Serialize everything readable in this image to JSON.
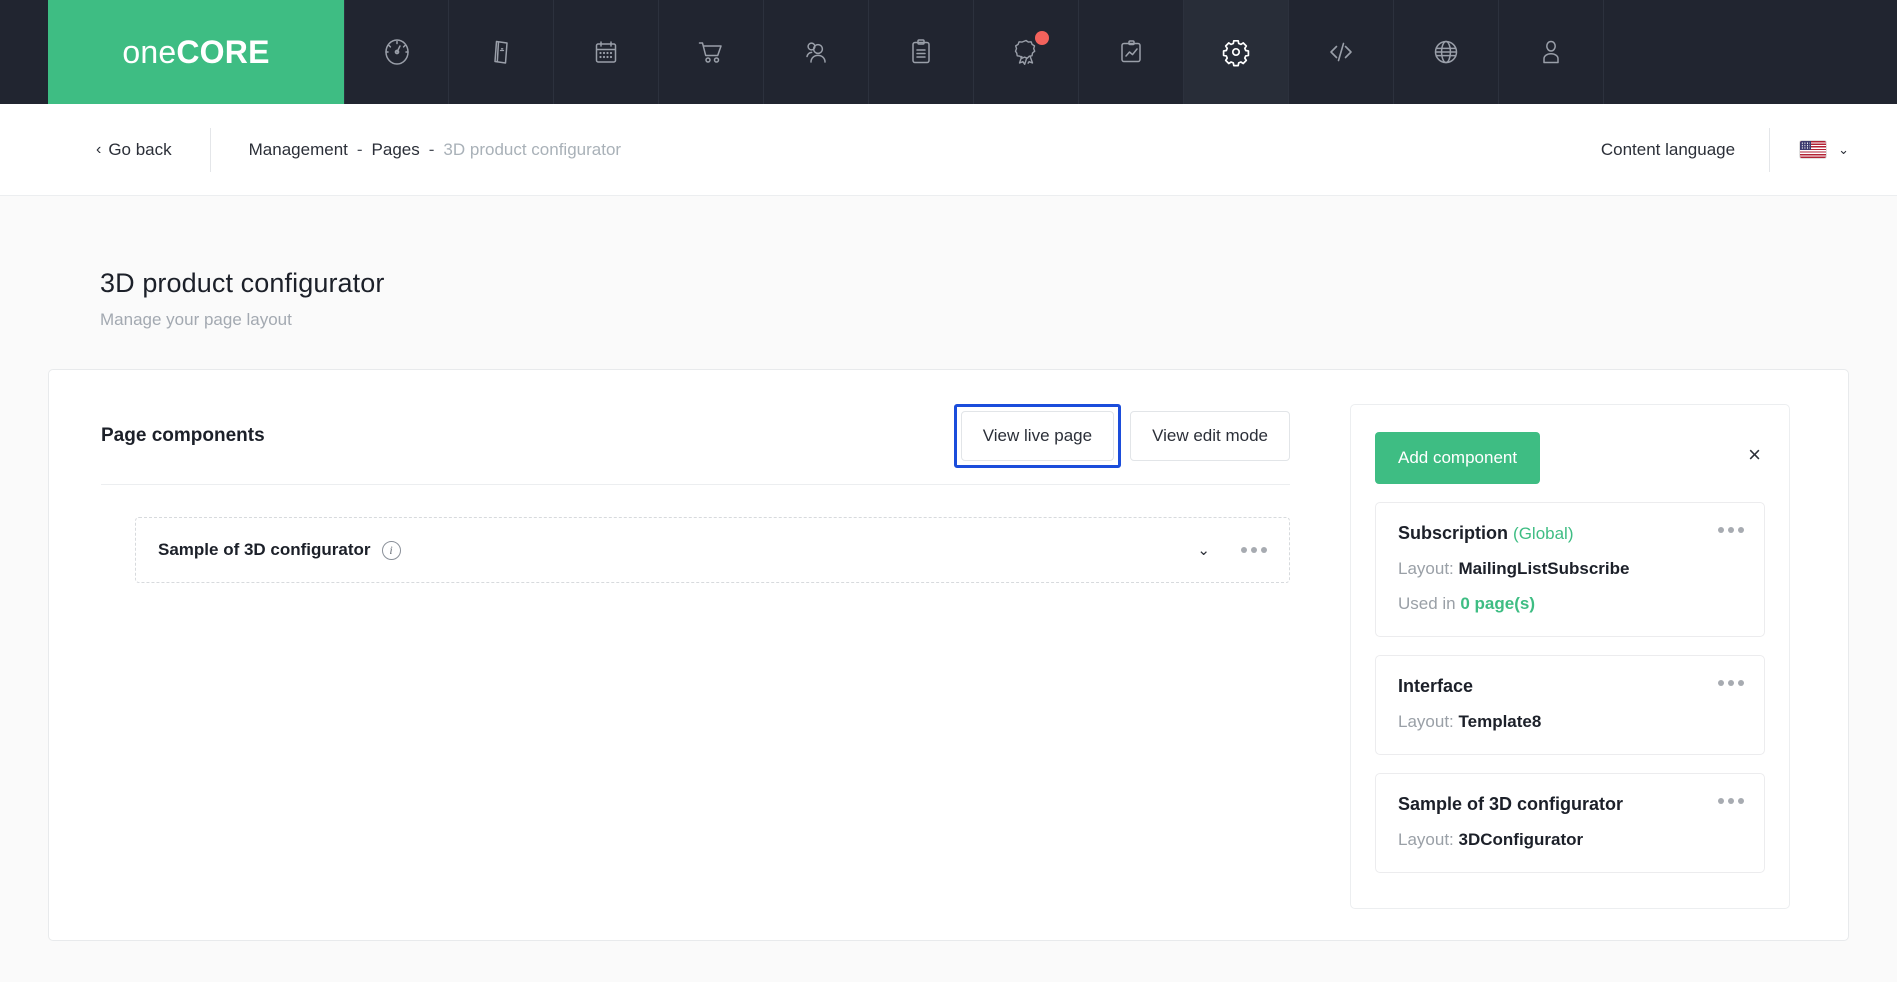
{
  "brand": {
    "logo_light": "one",
    "logo_bold": "CORE"
  },
  "topnav": {
    "items": [
      {
        "icon": "speedometer-icon",
        "name": "dashboard",
        "active": false,
        "badge": false
      },
      {
        "icon": "pages-icon",
        "name": "pages",
        "active": false,
        "badge": false
      },
      {
        "icon": "calendar-icon",
        "name": "calendar",
        "active": false,
        "badge": false
      },
      {
        "icon": "shopping-cart-icon",
        "name": "shop",
        "active": false,
        "badge": false
      },
      {
        "icon": "users-icon",
        "name": "customers",
        "active": false,
        "badge": false
      },
      {
        "icon": "clipboard-icon",
        "name": "tasks",
        "active": false,
        "badge": false
      },
      {
        "icon": "award-icon",
        "name": "achievements",
        "active": false,
        "badge": true
      },
      {
        "icon": "report-chart-icon",
        "name": "reports",
        "active": false,
        "badge": false
      },
      {
        "icon": "gear-icon",
        "name": "settings",
        "active": true,
        "badge": false
      },
      {
        "icon": "code-icon",
        "name": "developer",
        "active": false,
        "badge": false
      },
      {
        "icon": "globe-icon",
        "name": "website",
        "active": false,
        "badge": false
      },
      {
        "icon": "user-icon",
        "name": "account",
        "active": false,
        "badge": false
      }
    ]
  },
  "breadcrumb": {
    "go_back": "Go back",
    "items": [
      {
        "label": "Management",
        "current": false
      },
      {
        "label": "Pages",
        "current": false
      },
      {
        "label": "3D product configurator",
        "current": true
      }
    ],
    "separator": "-",
    "content_language_label": "Content language",
    "flag": "us-flag-icon",
    "chevron": "⌄"
  },
  "page": {
    "title": "3D product configurator",
    "subtitle": "Manage your page layout"
  },
  "components_panel": {
    "title": "Page components",
    "view_live_label": "View live page",
    "view_edit_label": "View edit mode",
    "rows": [
      {
        "name": "Sample of 3D configurator",
        "info_icon": "info-icon",
        "chevron": "⌄",
        "menu": "more-options-icon"
      }
    ]
  },
  "add_panel": {
    "add_label": "Add component",
    "close_icon": "close-icon",
    "cards": [
      {
        "title": "Subscription",
        "tag": "(Global)",
        "layout_label": "Layout:",
        "layout_value": "MailingListSubscribe",
        "usage_prefix": "Used in",
        "usage_value": "0 page(s)"
      },
      {
        "title": "Interface",
        "tag": "",
        "layout_label": "Layout:",
        "layout_value": "Template8",
        "usage_prefix": "",
        "usage_value": ""
      },
      {
        "title": "Sample of 3D configurator",
        "tag": "",
        "layout_label": "Layout:",
        "layout_value": "3DConfigurator",
        "usage_prefix": "",
        "usage_value": ""
      }
    ]
  },
  "colors": {
    "brand_green": "#3ebd83",
    "nav_dark": "#212530",
    "nav_active": "#282d38",
    "focus_blue": "#1b4ddb",
    "badge_red": "#f2625c",
    "page_bg": "#fafafa"
  }
}
